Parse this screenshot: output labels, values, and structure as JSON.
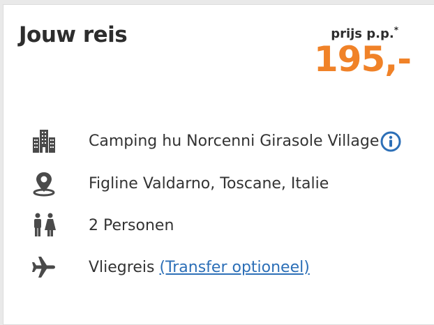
{
  "header": {
    "title": "Jouw reis",
    "price_label": "prijs p.p.",
    "price_footnote_mark": "*",
    "price_value": "195,-"
  },
  "details": {
    "accommodation": "Camping hu Norcenni Girasole Village",
    "location": "Figline Valdarno, Toscane, Italie",
    "persons": "2 Personen",
    "travel_type": "Vliegreis",
    "transfer_link": "(Transfer optioneel)"
  },
  "icons": {
    "accommodation": "building-icon",
    "location": "map-pin-icon",
    "persons": "persons-icon",
    "travel": "airplane-icon",
    "info": "info-icon"
  },
  "colors": {
    "price": "#f08228",
    "link": "#2c6fb7",
    "icon": "#4a4a4a",
    "text": "#333333"
  }
}
